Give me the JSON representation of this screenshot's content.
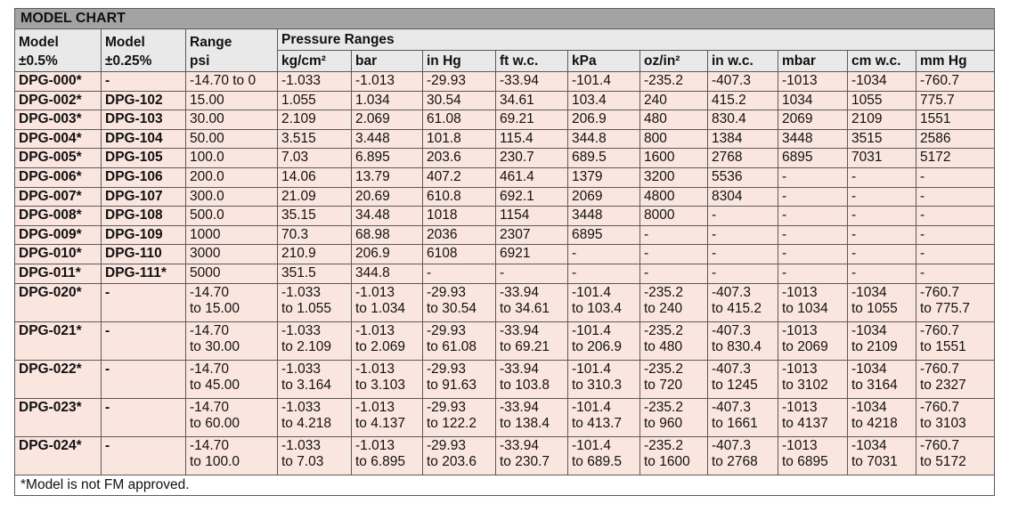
{
  "title": "MODEL CHART",
  "headers": {
    "model_05": [
      "Model",
      "±0.5%"
    ],
    "model_025": [
      "Model",
      "±0.25%"
    ],
    "range": [
      "Range",
      "psi"
    ],
    "pressure_ranges": "Pressure Ranges",
    "units": [
      "kg/cm²",
      "bar",
      "in Hg",
      "ft w.c.",
      "kPa",
      "oz/in²",
      "in w.c.",
      "mbar",
      "cm w.c.",
      "mm Hg"
    ]
  },
  "rows": [
    {
      "model_05": "DPG-000*",
      "model_025": "-",
      "cells": [
        [
          "-14.70 to 0"
        ],
        [
          "-1.033"
        ],
        [
          "-1.013"
        ],
        [
          "-29.93"
        ],
        [
          "-33.94"
        ],
        [
          "-101.4"
        ],
        [
          "-235.2"
        ],
        [
          "-407.3"
        ],
        [
          "-1013"
        ],
        [
          "-1034"
        ],
        [
          "-760.7"
        ]
      ]
    },
    {
      "model_05": "DPG-002*",
      "model_025": "DPG-102",
      "cells": [
        [
          "15.00"
        ],
        [
          "1.055"
        ],
        [
          "1.034"
        ],
        [
          "30.54"
        ],
        [
          "34.61"
        ],
        [
          "103.4"
        ],
        [
          "240"
        ],
        [
          "415.2"
        ],
        [
          "1034"
        ],
        [
          "1055"
        ],
        [
          "775.7"
        ]
      ]
    },
    {
      "model_05": "DPG-003*",
      "model_025": "DPG-103",
      "cells": [
        [
          "30.00"
        ],
        [
          "2.109"
        ],
        [
          "2.069"
        ],
        [
          "61.08"
        ],
        [
          "69.21"
        ],
        [
          "206.9"
        ],
        [
          "480"
        ],
        [
          "830.4"
        ],
        [
          "2069"
        ],
        [
          "2109"
        ],
        [
          "1551"
        ]
      ]
    },
    {
      "model_05": "DPG-004*",
      "model_025": "DPG-104",
      "cells": [
        [
          "50.00"
        ],
        [
          "3.515"
        ],
        [
          "3.448"
        ],
        [
          "101.8"
        ],
        [
          "115.4"
        ],
        [
          "344.8"
        ],
        [
          "800"
        ],
        [
          "1384"
        ],
        [
          "3448"
        ],
        [
          "3515"
        ],
        [
          "2586"
        ]
      ]
    },
    {
      "model_05": "DPG-005*",
      "model_025": "DPG-105",
      "cells": [
        [
          "100.0"
        ],
        [
          "7.03"
        ],
        [
          "6.895"
        ],
        [
          "203.6"
        ],
        [
          "230.7"
        ],
        [
          "689.5"
        ],
        [
          "1600"
        ],
        [
          "2768"
        ],
        [
          "6895"
        ],
        [
          "7031"
        ],
        [
          "5172"
        ]
      ]
    },
    {
      "model_05": "DPG-006*",
      "model_025": "DPG-106",
      "cells": [
        [
          "200.0"
        ],
        [
          "14.06"
        ],
        [
          "13.79"
        ],
        [
          "407.2"
        ],
        [
          "461.4"
        ],
        [
          "1379"
        ],
        [
          "3200"
        ],
        [
          "5536"
        ],
        [
          "-"
        ],
        [
          "-"
        ],
        [
          "-"
        ]
      ]
    },
    {
      "model_05": "DPG-007*",
      "model_025": "DPG-107",
      "cells": [
        [
          "300.0"
        ],
        [
          "21.09"
        ],
        [
          "20.69"
        ],
        [
          "610.8"
        ],
        [
          "692.1"
        ],
        [
          "2069"
        ],
        [
          "4800"
        ],
        [
          "8304"
        ],
        [
          "-"
        ],
        [
          "-"
        ],
        [
          "-"
        ]
      ]
    },
    {
      "model_05": "DPG-008*",
      "model_025": "DPG-108",
      "cells": [
        [
          "500.0"
        ],
        [
          "35.15"
        ],
        [
          "34.48"
        ],
        [
          "1018"
        ],
        [
          "1154"
        ],
        [
          "3448"
        ],
        [
          "8000"
        ],
        [
          "-"
        ],
        [
          "-"
        ],
        [
          "-"
        ],
        [
          "-"
        ]
      ]
    },
    {
      "model_05": "DPG-009*",
      "model_025": "DPG-109",
      "cells": [
        [
          "1000"
        ],
        [
          "70.3"
        ],
        [
          "68.98"
        ],
        [
          "2036"
        ],
        [
          "2307"
        ],
        [
          "6895"
        ],
        [
          "-"
        ],
        [
          "-"
        ],
        [
          "-"
        ],
        [
          "-"
        ],
        [
          "-"
        ]
      ]
    },
    {
      "model_05": "DPG-010*",
      "model_025": "DPG-110",
      "cells": [
        [
          "3000"
        ],
        [
          "210.9"
        ],
        [
          "206.9"
        ],
        [
          "6108"
        ],
        [
          "6921"
        ],
        [
          "-"
        ],
        [
          "-"
        ],
        [
          "-"
        ],
        [
          "-"
        ],
        [
          "-"
        ],
        [
          "-"
        ]
      ]
    },
    {
      "model_05": "DPG-011*",
      "model_025": "DPG-111*",
      "cells": [
        [
          "5000"
        ],
        [
          "351.5"
        ],
        [
          "344.8"
        ],
        [
          "-"
        ],
        [
          "-"
        ],
        [
          "-"
        ],
        [
          "-"
        ],
        [
          "-"
        ],
        [
          "-"
        ],
        [
          "-"
        ],
        [
          "-"
        ]
      ]
    },
    {
      "model_05": "DPG-020*",
      "model_025": "-",
      "cells": [
        [
          "-14.70",
          "to 15.00"
        ],
        [
          "-1.033",
          "to 1.055"
        ],
        [
          "-1.013",
          "to 1.034"
        ],
        [
          "-29.93",
          "to 30.54"
        ],
        [
          "-33.94",
          "to 34.61"
        ],
        [
          "-101.4",
          "to 103.4"
        ],
        [
          "-235.2",
          "to 240"
        ],
        [
          "-407.3",
          "to 415.2"
        ],
        [
          "-1013",
          "to 1034"
        ],
        [
          "-1034",
          "to 1055"
        ],
        [
          "-760.7",
          "to 775.7"
        ]
      ]
    },
    {
      "model_05": "DPG-021*",
      "model_025": "-",
      "cells": [
        [
          "-14.70",
          "to 30.00"
        ],
        [
          "-1.033",
          "to 2.109"
        ],
        [
          "-1.013",
          "to 2.069"
        ],
        [
          "-29.93",
          "to 61.08"
        ],
        [
          "-33.94",
          "to 69.21"
        ],
        [
          "-101.4",
          "to 206.9"
        ],
        [
          "-235.2",
          "to 480"
        ],
        [
          "-407.3",
          "to 830.4"
        ],
        [
          "-1013",
          "to 2069"
        ],
        [
          "-1034",
          "to 2109"
        ],
        [
          "-760.7",
          "to 1551"
        ]
      ]
    },
    {
      "model_05": "DPG-022*",
      "model_025": "-",
      "cells": [
        [
          "-14.70",
          "to 45.00"
        ],
        [
          "-1.033",
          "to 3.164"
        ],
        [
          "-1.013",
          "to 3.103"
        ],
        [
          "-29.93",
          "to 91.63"
        ],
        [
          "-33.94",
          "to 103.8"
        ],
        [
          "-101.4",
          "to 310.3"
        ],
        [
          "-235.2",
          "to 720"
        ],
        [
          "-407.3",
          "to 1245"
        ],
        [
          "-1013",
          "to 3102"
        ],
        [
          "-1034",
          "to 3164"
        ],
        [
          "-760.7",
          "to 2327"
        ]
      ]
    },
    {
      "model_05": "DPG-023*",
      "model_025": "-",
      "cells": [
        [
          "-14.70",
          "to 60.00"
        ],
        [
          "-1.033",
          "to 4.218"
        ],
        [
          "-1.013",
          "to 4.137"
        ],
        [
          "-29.93",
          "to 122.2"
        ],
        [
          "-33.94",
          "to 138.4"
        ],
        [
          "-101.4",
          "to 413.7"
        ],
        [
          "-235.2",
          "to 960"
        ],
        [
          "-407.3",
          "to 1661"
        ],
        [
          "-1013",
          "to 4137"
        ],
        [
          "-1034",
          "to 4218"
        ],
        [
          "-760.7",
          "to 3103"
        ]
      ]
    },
    {
      "model_05": "DPG-024*",
      "model_025": "-",
      "cells": [
        [
          "-14.70",
          "to 100.0"
        ],
        [
          "-1.033",
          "to 7.03"
        ],
        [
          "-1.013",
          "to 6.895"
        ],
        [
          "-29.93",
          "to 203.6"
        ],
        [
          "-33.94",
          "to 230.7"
        ],
        [
          "-101.4",
          "to 689.5"
        ],
        [
          "-235.2",
          "to 1600"
        ],
        [
          "-407.3",
          "to 2768"
        ],
        [
          "-1013",
          "to 6895"
        ],
        [
          "-1034",
          "to 7031"
        ],
        [
          "-760.7",
          "to 5172"
        ]
      ]
    }
  ],
  "footnote": "*Model is not FM approved."
}
